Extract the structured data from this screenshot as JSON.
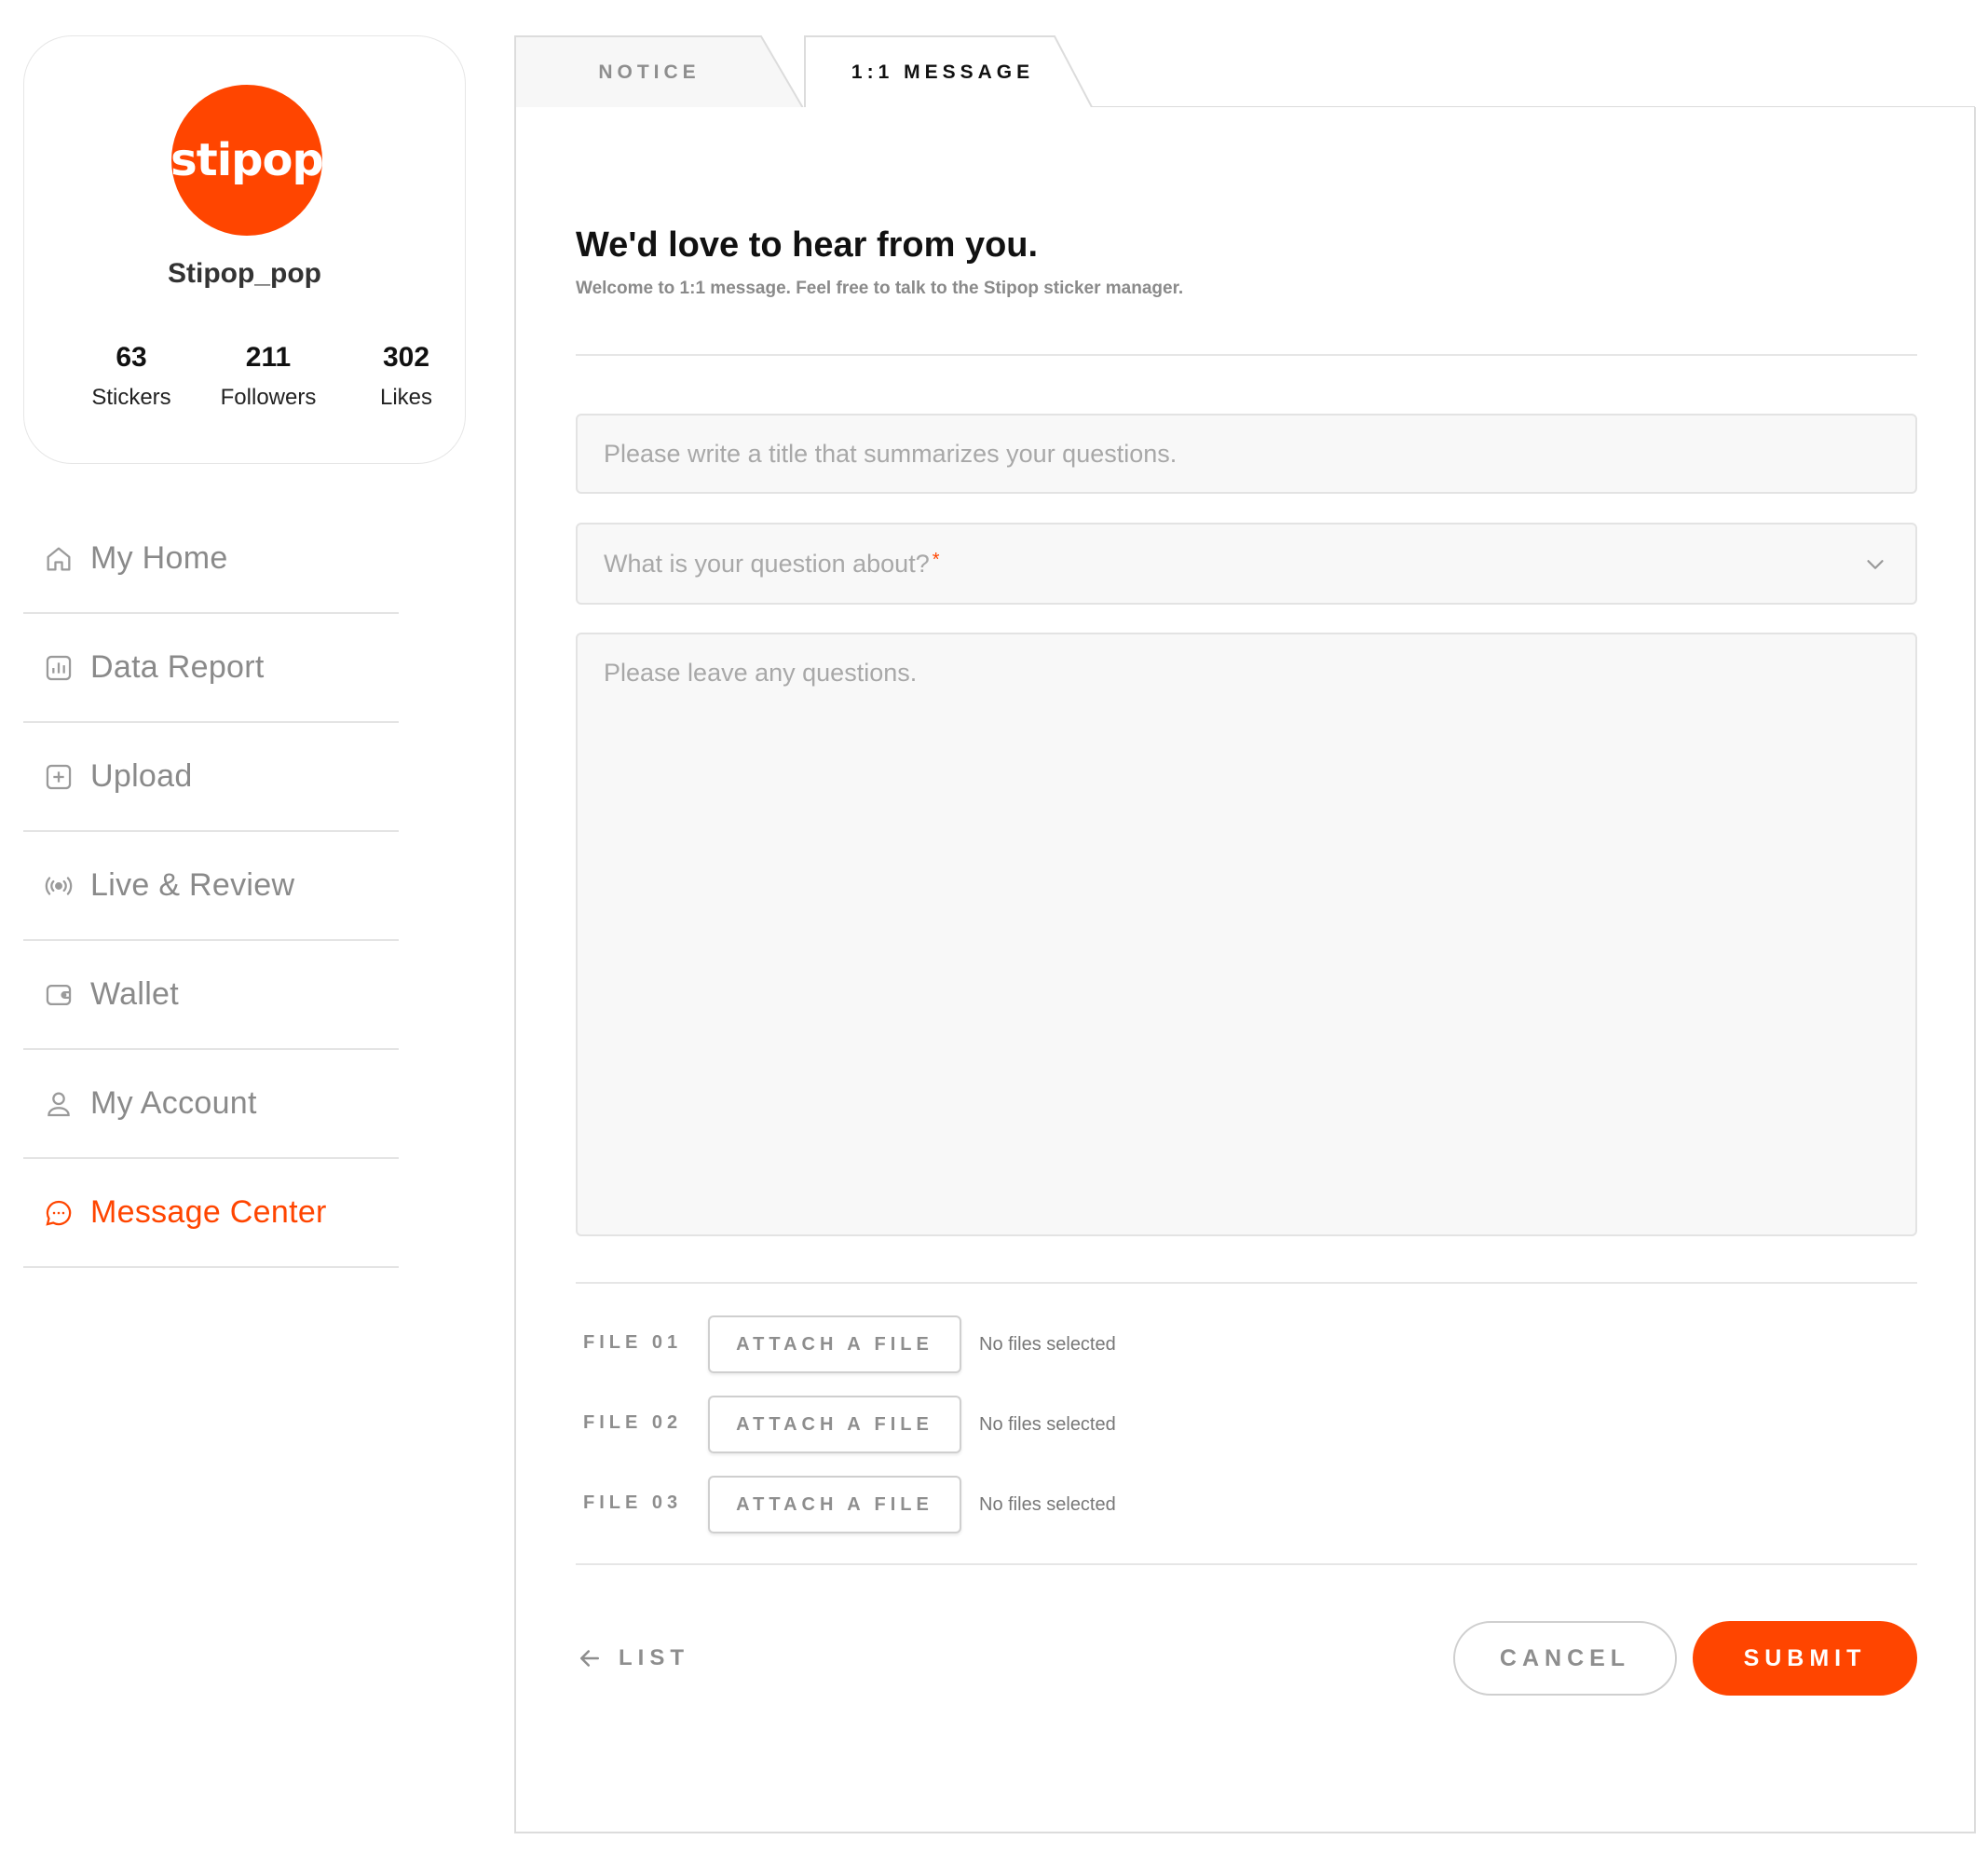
{
  "profile": {
    "logo_text": "stipop",
    "username": "Stipop_pop",
    "stats": [
      {
        "value": "63",
        "label": "Stickers"
      },
      {
        "value": "211",
        "label": "Followers"
      },
      {
        "value": "302",
        "label": "Likes"
      }
    ]
  },
  "sidebar": {
    "items": [
      {
        "label": "My Home",
        "icon": "home-icon"
      },
      {
        "label": "Data Report",
        "icon": "bar-chart-icon"
      },
      {
        "label": "Upload",
        "icon": "plus-square-icon"
      },
      {
        "label": "Live & Review",
        "icon": "broadcast-icon"
      },
      {
        "label": "Wallet",
        "icon": "wallet-icon"
      },
      {
        "label": "My Account",
        "icon": "user-icon"
      },
      {
        "label": "Message Center",
        "icon": "chat-bubble-icon",
        "active": true
      }
    ]
  },
  "tabs": [
    {
      "label": "NOTICE",
      "active": false
    },
    {
      "label": "1:1 MESSAGE",
      "active": true
    }
  ],
  "form": {
    "heading": "We'd love to hear from you.",
    "subheading": "Welcome to 1:1 message. Feel free to talk to the Stipop sticker manager.",
    "title_placeholder": "Please write a title that summarizes your questions.",
    "category_placeholder": "What is your question about?",
    "category_required_mark": "*",
    "message_placeholder": "Please leave any questions.",
    "files": [
      {
        "label": "FILE 01",
        "button": "ATTACH A FILE",
        "status": "No files selected"
      },
      {
        "label": "FILE 02",
        "button": "ATTACH A FILE",
        "status": "No files selected"
      },
      {
        "label": "FILE 03",
        "button": "ATTACH A FILE",
        "status": "No files selected"
      }
    ],
    "list_label": "LIST",
    "cancel_label": "CANCEL",
    "submit_label": "SUBMIT"
  },
  "colors": {
    "accent": "#ff4500",
    "muted_text": "#8a8a8a",
    "border": "#e3e3e3",
    "field_bg": "#f8f8f8"
  }
}
